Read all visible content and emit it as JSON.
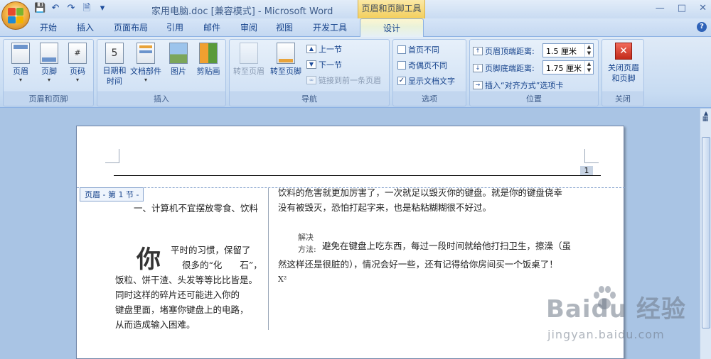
{
  "window": {
    "title": "家用电脑.doc [兼容模式] - Microsoft Word",
    "contextual_tab_title": "页眉和页脚工具",
    "controls": [
      "minimize",
      "maximize",
      "close"
    ]
  },
  "quick_access": [
    "save-icon",
    "undo-icon",
    "redo-icon",
    "print-preview-icon",
    "customize-icon"
  ],
  "tabs": [
    {
      "label": "开始"
    },
    {
      "label": "插入"
    },
    {
      "label": "页面布局"
    },
    {
      "label": "引用"
    },
    {
      "label": "邮件"
    },
    {
      "label": "审阅"
    },
    {
      "label": "视图"
    },
    {
      "label": "开发工具"
    },
    {
      "label": "设计",
      "active": true
    }
  ],
  "ribbon": {
    "group_header_footer": {
      "label": "页眉和页脚",
      "buttons": [
        {
          "label": "页眉"
        },
        {
          "label": "页脚"
        },
        {
          "label": "页码"
        }
      ]
    },
    "group_insert": {
      "label": "插入",
      "buttons": [
        {
          "label": "日期和时间"
        },
        {
          "label": "文档部件"
        },
        {
          "label": "图片"
        },
        {
          "label": "剪贴画"
        }
      ]
    },
    "group_nav": {
      "label": "导航",
      "goto_header": "转至页眉",
      "goto_footer": "转至页脚",
      "prev_section": "上一节",
      "next_section": "下一节",
      "link_prev": "链接到前一条页眉"
    },
    "group_options": {
      "label": "选项",
      "diff_first": {
        "label": "首页不同",
        "checked": false
      },
      "diff_odd_even": {
        "label": "奇偶页不同",
        "checked": false
      },
      "show_doc_text": {
        "label": "显示文档文字",
        "checked": true
      }
    },
    "group_position": {
      "label": "位置",
      "header_top_label": "页眉顶端距离:",
      "header_top_value": "1.5 厘米",
      "footer_bottom_label": "页脚底端距离:",
      "footer_bottom_value": "1.75 厘米",
      "insert_align_tab": "插入“对齐方式”选项卡"
    },
    "group_close": {
      "label": "关闭",
      "close_btn": "关闭页眉和页脚"
    }
  },
  "document": {
    "page_number": "1",
    "header_tag": "页眉 - 第 1 节 -",
    "left_heading": "一、计算机不宜摆放零食、饮料",
    "left_dropcap": "你",
    "left_para_lines": [
      "平时的习惯，保留了",
      "很多的“化　　石”，",
      "饭粒、饼干渣、头发等等比比皆是。",
      "同时这样的碎片还可能进入你的",
      "键盘里面，堵塞你键盘上的电路，",
      "从而造成输入困难。"
    ],
    "right_para1_lines": [
      "饮料的危害就更加厉害了，一次就足以毁灭你的键盘。就是你的键盘侥幸",
      "没有被毁灭，恐怕打起字来，也是粘粘糊糊很不好过。"
    ],
    "solution_label_1": "解决",
    "solution_label_2": "方法:",
    "right_para2_lines": [
      "避免在键盘上吃东西，每过一段时间就给他打扫卫生，擦澡（虽",
      "然这样还是很脏的），情况会好一些，还有记得给你房间买一个饭桌了！"
    ],
    "x2_marker": "X²"
  },
  "watermark": {
    "main": "Bai",
    "main2": "du 经验",
    "sub": "jingyan.baidu.com"
  }
}
